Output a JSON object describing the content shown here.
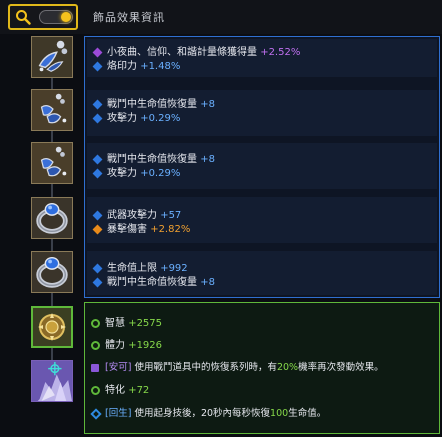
{
  "header": {
    "title": "飾品效果資訊",
    "toggle_state": "on",
    "accent_color": "#e0b81a"
  },
  "accessories": [
    {
      "icon": "earring-icon",
      "frame": "gold"
    },
    {
      "icon": "earring-icon",
      "frame": "gold"
    },
    {
      "icon": "earring-icon",
      "frame": "gold"
    },
    {
      "icon": "ring-icon",
      "frame": "gold"
    },
    {
      "icon": "ring-icon",
      "frame": "gold"
    },
    {
      "icon": "amulet-icon",
      "frame": "green"
    },
    {
      "icon": "crystal-icon",
      "frame": "purple"
    }
  ],
  "blue_panel": [
    {
      "lines": [
        {
          "label": "小夜曲、信仰、和諧計量條獲得量",
          "value": "+2.52%",
          "bullet": "purple"
        },
        {
          "label": "烙印力",
          "value": "+1.48%",
          "bullet": "blue"
        }
      ]
    },
    {
      "lines": [
        {
          "label": "戰鬥中生命值恢復量",
          "value": "+8",
          "bullet": "blue"
        },
        {
          "label": "攻擊力",
          "value": "+0.29%",
          "bullet": "blue"
        }
      ]
    },
    {
      "lines": [
        {
          "label": "戰鬥中生命值恢復量",
          "value": "+8",
          "bullet": "blue"
        },
        {
          "label": "攻擊力",
          "value": "+0.29%",
          "bullet": "blue"
        }
      ]
    },
    {
      "lines": [
        {
          "label": "武器攻擊力",
          "value": "+57",
          "bullet": "blue"
        },
        {
          "label": "暴擊傷害",
          "value": "+2.82%",
          "bullet": "orange"
        }
      ]
    },
    {
      "lines": [
        {
          "label": "生命值上限",
          "value": "+992",
          "bullet": "blue"
        },
        {
          "label": "戰鬥中生命值恢復量",
          "value": "+8",
          "bullet": "blue"
        }
      ]
    }
  ],
  "green_panel": {
    "wisdom": {
      "label": "智慧",
      "value": "+2575"
    },
    "vitality": {
      "label": "體力",
      "value": "+1926"
    },
    "safe_effect": {
      "tag": "[安可]",
      "text_a": "使用戰鬥道具中的恢復系列時，有",
      "pct": "20%",
      "text_b": "機率再次發動效果。"
    },
    "specialization": {
      "label": "特化",
      "value": "+72"
    },
    "regen_effect": {
      "tag": "[回生]",
      "text_a": "使用起身技後，20秒內每秒恢復",
      "amount": "100",
      "text_b": "生命值。"
    }
  }
}
